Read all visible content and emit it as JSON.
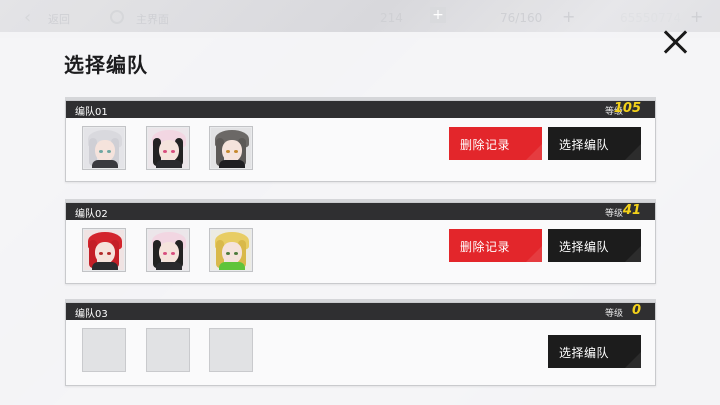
{
  "topbar": {
    "back_label": "返回",
    "home_label": "主界面",
    "resource1": "214",
    "resource2": "76/160",
    "coins": "65550774"
  },
  "modal": {
    "title": "选择编队"
  },
  "level_label": "等级",
  "teams": [
    {
      "name": "编队01",
      "level": "105",
      "delete_label": "删除记录",
      "select_label": "选择编队"
    },
    {
      "name": "编队02",
      "level": "41",
      "delete_label": "删除记录",
      "select_label": "选择编队"
    },
    {
      "name": "编队03",
      "level": "0",
      "select_label": "选择编队"
    }
  ],
  "colors": {
    "delete_button": "#e3262b",
    "select_button": "#1c1c1c",
    "level_value": "#f4d21a",
    "header_bar": "#2f2f31"
  },
  "icons": {
    "back": "chevron-left-icon",
    "home": "circle-home-icon",
    "plus": "plus-icon",
    "close": "close-icon"
  }
}
